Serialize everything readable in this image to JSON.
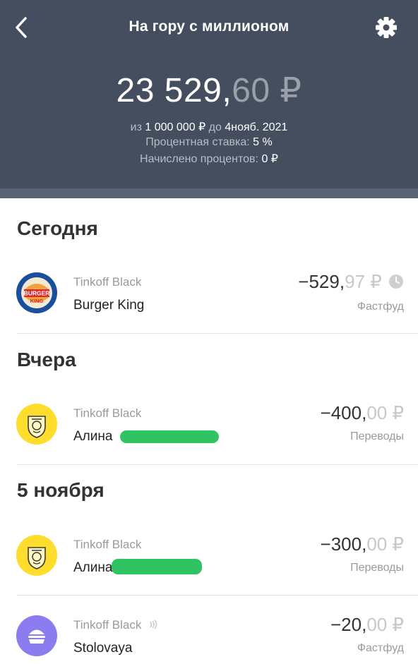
{
  "header": {
    "title": "На гору с миллионом",
    "amount_main": "23 529,",
    "amount_cents": "60 ₽",
    "goal_prefix": "из",
    "goal_value": "1 000 000 ₽",
    "goal_mid": "до",
    "goal_date": "4нояб. 2021",
    "rate_label": "Процентная ставка:",
    "rate_value": "5 %",
    "accrued_label": "Начислено процентов:",
    "accrued_value": "0 ₽"
  },
  "sections": [
    {
      "title": "Сегодня",
      "transactions": [
        {
          "account": "Tinkoff Black",
          "merchant": "Burger King",
          "amount_main": "−529,",
          "amount_cents": "97 ₽",
          "category": "Фастфуд",
          "icon": "burger-king-logo",
          "pending": true
        }
      ]
    },
    {
      "title": "Вчера",
      "transactions": [
        {
          "account": "Tinkoff Black",
          "merchant": "Алина",
          "amount_main": "−400,",
          "amount_cents": "00 ₽",
          "category": "Переводы",
          "icon": "tinkoff-logo"
        }
      ]
    },
    {
      "title": "5 ноября",
      "transactions": [
        {
          "account": "Tinkoff Black",
          "merchant": "Алина",
          "amount_main": "−300,",
          "amount_cents": "00 ₽",
          "category": "Переводы",
          "icon": "tinkoff-logo"
        },
        {
          "account": "Tinkoff Black",
          "merchant": "Stolovaya",
          "amount_main": "−20,",
          "amount_cents": "00 ₽",
          "category": "Фастфуд",
          "icon": "burger-icon",
          "contactless": true
        }
      ]
    }
  ],
  "colors": {
    "header_bg": "#454e5e",
    "burger_king_blue": "#1a4f9c",
    "tinkoff_yellow": "#ffdd2d",
    "fastfood_purple": "#8b7df0",
    "redaction_green": "#25c05a"
  }
}
